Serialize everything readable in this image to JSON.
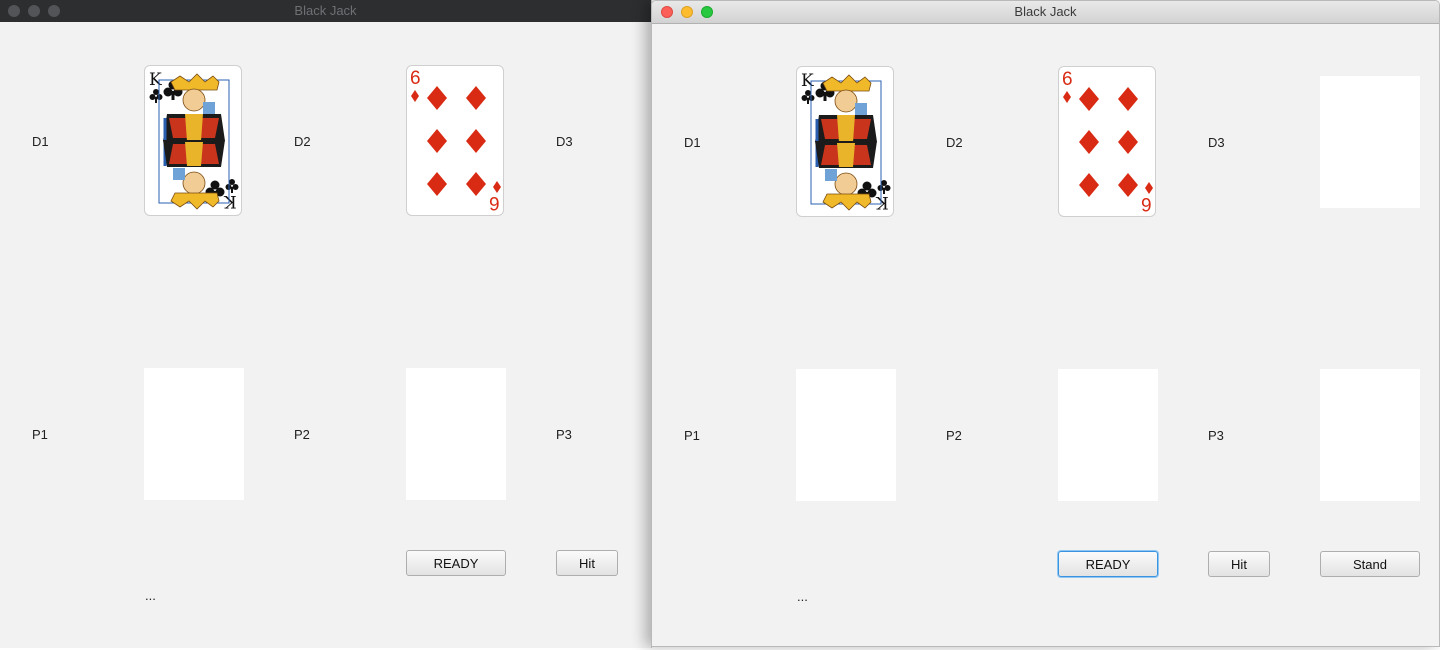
{
  "windows": [
    {
      "title": "Black Jack",
      "active": false,
      "dealer_labels": [
        "D1",
        "D2",
        "D3"
      ],
      "player_labels": [
        "P1",
        "P2",
        "P3"
      ],
      "buttons": {
        "ready": "READY",
        "hit": "Hit"
      },
      "status": "...",
      "dealer_cards": [
        "K of clubs",
        "6 of diamonds"
      ]
    },
    {
      "title": "Black Jack",
      "active": true,
      "dealer_labels": [
        "D1",
        "D2",
        "D3"
      ],
      "player_labels": [
        "P1",
        "P2",
        "P3"
      ],
      "buttons": {
        "ready": "READY",
        "hit": "Hit",
        "stand": "Stand"
      },
      "status": "...",
      "dealer_cards": [
        "K of clubs",
        "6 of diamonds"
      ]
    }
  ],
  "card_text": {
    "king_rank": "K",
    "six_rank": "6"
  },
  "colors": {
    "window_bg": "#f2f2f2",
    "suit_red": "#d92b14",
    "focus_ring": "#3a94e0"
  }
}
